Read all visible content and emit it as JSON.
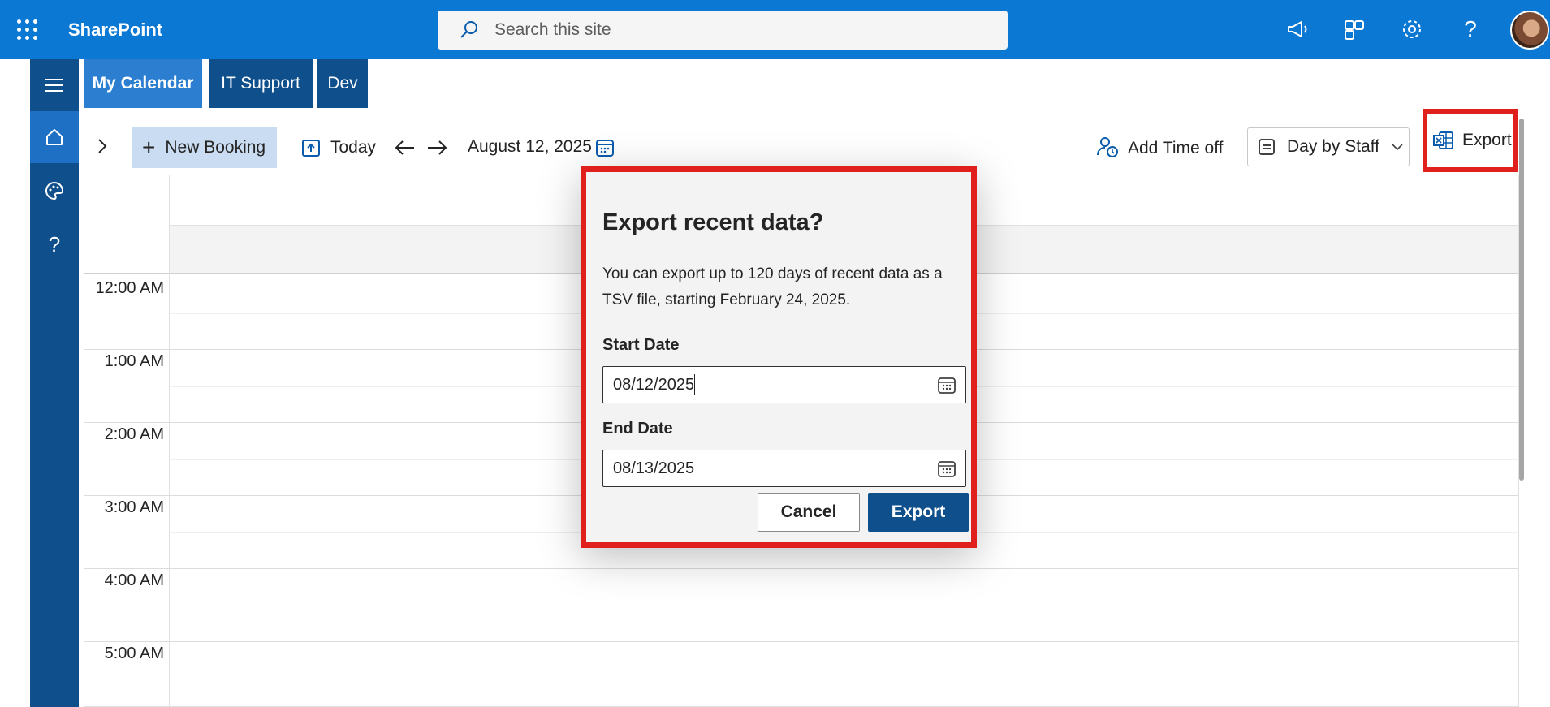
{
  "app": {
    "name": "SharePoint"
  },
  "search": {
    "placeholder": "Search this site"
  },
  "tabs": [
    {
      "label": "My Calendar"
    },
    {
      "label": "IT Support"
    },
    {
      "label": "Dev"
    }
  ],
  "toolbar": {
    "new_booking": "New Booking",
    "today": "Today",
    "date": "August 12, 2025",
    "add_time_off": "Add Time off",
    "view": "Day by Staff",
    "export": "Export"
  },
  "calendar": {
    "times": [
      "12:00 AM",
      "1:00 AM",
      "2:00 AM",
      "3:00 AM",
      "4:00 AM",
      "5:00 AM"
    ]
  },
  "dialog": {
    "title": "Export recent data?",
    "message": "You can export up to 120 days of recent data as a TSV file, starting February 24, 2025.",
    "start_label": "Start Date",
    "start_value": "08/12/2025",
    "end_label": "End Date",
    "end_value": "08/13/2025",
    "cancel": "Cancel",
    "export": "Export"
  },
  "colors": {
    "suite_bar": "#0b78d4",
    "rail": "#0f4f8c",
    "primary_button": "#0f4f8c",
    "highlight": "#e0201c"
  }
}
